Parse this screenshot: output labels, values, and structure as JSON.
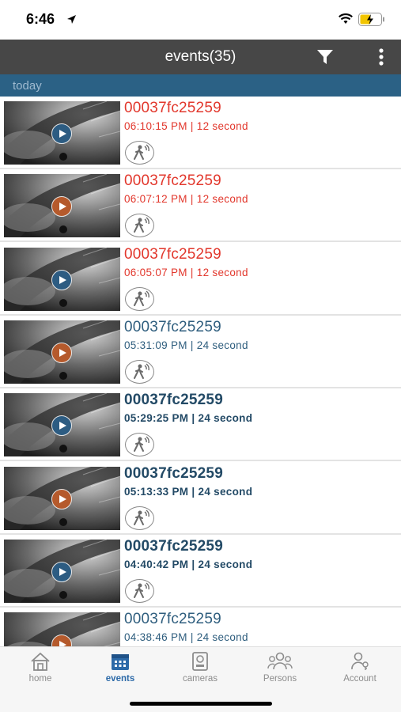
{
  "status": {
    "time": "6:46"
  },
  "header": {
    "title": "events(35)"
  },
  "section": {
    "label": "today"
  },
  "events": [
    {
      "device": "00037fc25259",
      "meta": "06:10:15 PM | 12 second",
      "style": "red",
      "play": "blue"
    },
    {
      "device": "00037fc25259",
      "meta": "06:07:12 PM | 12 second",
      "style": "red",
      "play": "orange"
    },
    {
      "device": "00037fc25259",
      "meta": "06:05:07 PM | 12 second",
      "style": "red",
      "play": "blue"
    },
    {
      "device": "00037fc25259",
      "meta": "05:31:09 PM | 24 second",
      "style": "blue",
      "play": "orange"
    },
    {
      "device": "00037fc25259",
      "meta": "05:29:25 PM | 24 second",
      "style": "bold",
      "play": "blue"
    },
    {
      "device": "00037fc25259",
      "meta": "05:13:33 PM | 24 second",
      "style": "bold",
      "play": "orange"
    },
    {
      "device": "00037fc25259",
      "meta": "04:40:42 PM | 24 second",
      "style": "bold",
      "play": "blue"
    },
    {
      "device": "00037fc25259",
      "meta": "04:38:46 PM | 24 second",
      "style": "blue",
      "play": "orange"
    }
  ],
  "tabs": {
    "home": "home",
    "events": "events",
    "cameras": "cameras",
    "persons": "Persons",
    "account": "Account"
  },
  "colors": {
    "header": "#474747",
    "section": "#2b6185",
    "alert_red": "#e2372c",
    "event_blue": "#2f5e7e",
    "active_tab": "#2d6aa8"
  },
  "icons": {
    "filter": "filter-icon",
    "more": "more-vertical-icon",
    "motion": "motion-person-icon",
    "play": "play-icon"
  }
}
